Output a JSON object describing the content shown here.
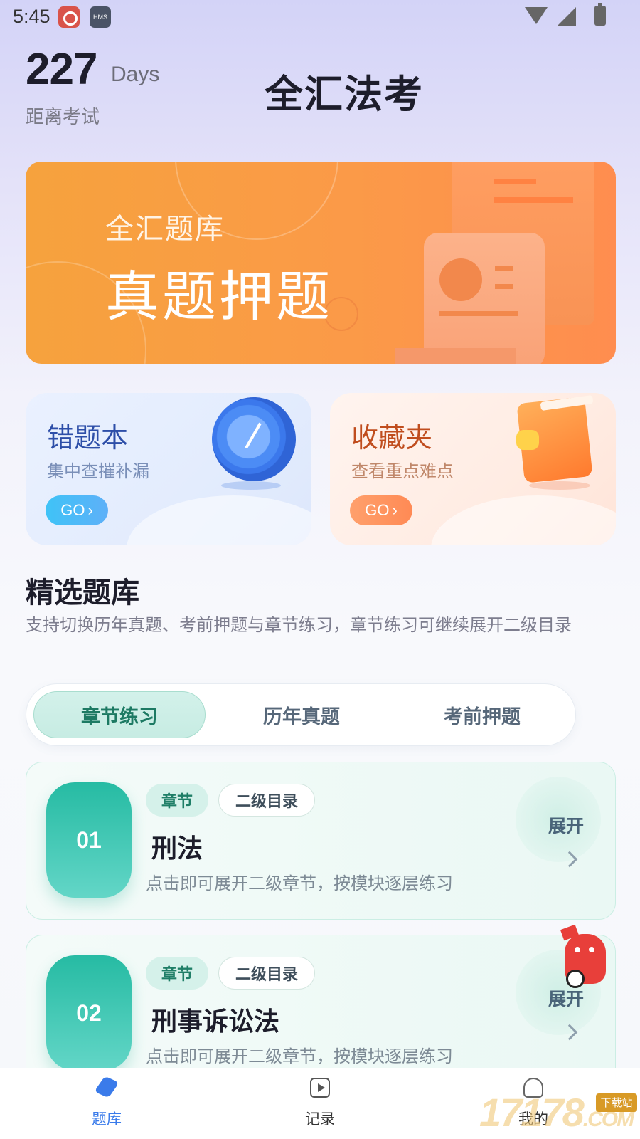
{
  "status_bar": {
    "time": "5:45",
    "app_badge": "HMS"
  },
  "header": {
    "days_number": "227",
    "days_unit": "Days",
    "days_caption": "距离考试",
    "app_title": "全汇法考"
  },
  "banner": {
    "subtitle": "全汇题库",
    "title": "真题押题"
  },
  "feature_cards": [
    {
      "title": "错题本",
      "description": "集中查摧补漏",
      "button": "GO",
      "icon": "target-icon"
    },
    {
      "title": "收藏夹",
      "description": "查看重点难点",
      "button": "GO",
      "icon": "book-icon"
    }
  ],
  "section": {
    "title": "精选题库",
    "description": "支持切换历年真题、考前押题与章节练习，章节练习可继续展开二级目录"
  },
  "tabs": [
    {
      "label": "章节练习",
      "active": true
    },
    {
      "label": "历年真题",
      "active": false
    },
    {
      "label": "考前押题",
      "active": false
    }
  ],
  "chapters": [
    {
      "number": "01",
      "chip_type": "章节",
      "chip_sub": "二级目录",
      "name": "刑法",
      "description": "点击即可展开二级章节，按模块逐层练习",
      "expand_label": "展开"
    },
    {
      "number": "02",
      "chip_type": "章节",
      "chip_sub": "二级目录",
      "name": "刑事诉讼法",
      "description": "点击即可展开二级章节，按模块逐层练习",
      "expand_label": "展开"
    }
  ],
  "bottom_nav": [
    {
      "label": "题库",
      "icon": "pencil-icon",
      "active": true
    },
    {
      "label": "记录",
      "icon": "play-icon",
      "active": false
    },
    {
      "label": "我的",
      "icon": "user-icon",
      "active": false
    }
  ],
  "watermark": {
    "text": "17178",
    "badge": "下载站",
    "suffix": ".COM"
  },
  "colors": {
    "accent_blue": "#3a7bea",
    "accent_teal": "#26bba3",
    "banner_orange": "#fb9a48",
    "tab_active_text": "#1d7a63"
  }
}
